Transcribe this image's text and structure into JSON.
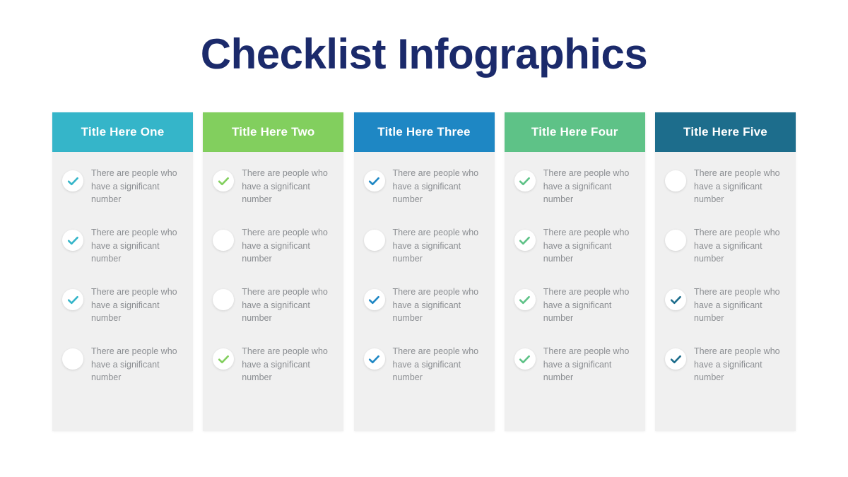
{
  "slide": {
    "title": "Checklist Infographics",
    "title_color": "#1b2a6b",
    "background_color": "#ffffff"
  },
  "common": {
    "item_text": "There are people who have a significant number",
    "body_background": "#f0f0f0",
    "body_text_color": "#8b8e92",
    "circle_color": "#ffffff",
    "checked_icon": "check-icon",
    "unchecked_icon": "empty-circle-icon"
  },
  "columns": [
    {
      "title": "Title Here One",
      "accent_color": "#35b5c9",
      "items": [
        {
          "text": "There are people who have a significant number",
          "checked": true
        },
        {
          "text": "There are people who have a significant number",
          "checked": true
        },
        {
          "text": "There are people who have a significant number",
          "checked": true
        },
        {
          "text": "There are people who have a significant number",
          "checked": false
        }
      ]
    },
    {
      "title": "Title Here Two",
      "accent_color": "#82cf5e",
      "items": [
        {
          "text": "There are people who have a significant number",
          "checked": true
        },
        {
          "text": "There are people who have a significant number",
          "checked": false
        },
        {
          "text": "There are people who have a significant number",
          "checked": false
        },
        {
          "text": "There are people who have a significant number",
          "checked": true
        }
      ]
    },
    {
      "title": "Title Here Three",
      "accent_color": "#1e87c4",
      "items": [
        {
          "text": "There are people who have a significant number",
          "checked": true
        },
        {
          "text": "There are people who have a significant number",
          "checked": false
        },
        {
          "text": "There are people who have a significant number",
          "checked": true
        },
        {
          "text": "There are people who have a significant number",
          "checked": true
        }
      ]
    },
    {
      "title": "Title Here Four",
      "accent_color": "#5ec287",
      "items": [
        {
          "text": "There are people who have a significant number",
          "checked": true
        },
        {
          "text": "There are people who have a significant number",
          "checked": true
        },
        {
          "text": "There are people who have a significant number",
          "checked": true
        },
        {
          "text": "There are people who have a significant number",
          "checked": true
        }
      ]
    },
    {
      "title": "Title Here Five",
      "accent_color": "#1d6d8c",
      "items": [
        {
          "text": "There are people who have a significant number",
          "checked": false
        },
        {
          "text": "There are people who have a significant number",
          "checked": false
        },
        {
          "text": "There are people who have a significant number",
          "checked": true
        },
        {
          "text": "There are people who have a significant number",
          "checked": true
        }
      ]
    }
  ]
}
